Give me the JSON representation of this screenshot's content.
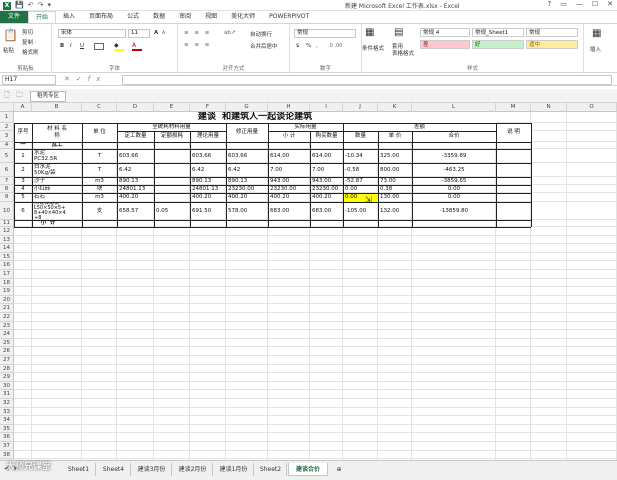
{
  "window": {
    "title": "新建 Microsoft Excel 工作表.xlsx - Excel",
    "controls": [
      "?",
      "▭",
      "—",
      "☐",
      "✕"
    ]
  },
  "quick_access": {
    "save": "💾",
    "undo": "↶",
    "redo": "↷",
    "more": "▾"
  },
  "ribbon_tabs": [
    "文件",
    "开始",
    "插入",
    "页面布局",
    "公式",
    "数据",
    "审阅",
    "视图",
    "美化大师",
    "POWERPIVOT"
  ],
  "active_tab": "开始",
  "ribbon": {
    "clipboard": {
      "paste": "粘贴",
      "cut": "剪切",
      "copy": "复制 ·",
      "format_painter": "格式刷",
      "label": "剪贴板"
    },
    "font": {
      "name": "宋体",
      "size": "11",
      "bold": "B",
      "italic": "I",
      "underline": "U",
      "label": "字体",
      "grow": "A",
      "shrink": "A"
    },
    "alignment": {
      "wrap": "自动换行",
      "merge": "合并后居中",
      "label": "对齐方式"
    },
    "number": {
      "format": "常规",
      "currency": "$",
      "percent": "%",
      "comma": ",",
      "label": "数字"
    },
    "styles": {
      "conditional": "条件格式",
      "table": "套用\n表格格式",
      "cells": [
        {
          "text": "常规 4",
          "bg": "#ffffff"
        },
        {
          "text": "常规_Sheet1",
          "bg": "#ffffff"
        },
        {
          "text": "常规",
          "bg": "#ffffff"
        },
        {
          "text": "差",
          "bg": "#ffc7ce",
          "color": "#9c0006"
        },
        {
          "text": "好",
          "bg": "#c6efce",
          "color": "#006100"
        },
        {
          "text": "适中",
          "bg": "#ffeb9c",
          "color": "#9c5700"
        }
      ],
      "label": "样式"
    },
    "cells_group": {
      "insert": "插入"
    }
  },
  "formula_bar": {
    "name_box": "H17",
    "cancel": "✕",
    "enter": "✓",
    "fx": "fx",
    "value": ""
  },
  "doc_tab": "稻壳专区",
  "columns": [
    "A",
    "B",
    "C",
    "D",
    "E",
    "F",
    "G",
    "H",
    "I",
    "J",
    "K",
    "L",
    "M",
    "N",
    "O"
  ],
  "rows": [
    "1",
    "2",
    "3",
    "4",
    "5",
    "6",
    "7",
    "8",
    "9",
    "10",
    "11",
    "12",
    "13",
    "14",
    "15",
    "16",
    "17",
    "18",
    "19",
    "20",
    "21",
    "22",
    "23",
    "24",
    "25",
    "26",
    "27",
    "28",
    "29",
    "30",
    "31",
    "32",
    "33",
    "34",
    "35",
    "36",
    "37",
    "38",
    "39",
    "40"
  ],
  "sheet": {
    "title": "建谈  和建筑人一起谈论建筑",
    "headers": {
      "seq": "序号",
      "material_name": "材 料 名\n称",
      "unit": "单 位",
      "consumption_group": "全统耗材料用量",
      "quota_amount": "定工数量",
      "quota_loss": "定额损耗",
      "theory": "理论用量",
      "corrected": "修正用量",
      "actual_group": "实际用量",
      "subtotal": "小 计",
      "purchase": "购买数量",
      "diff_group": "差额",
      "qty": "数量",
      "price": "单 价",
      "total": "合价",
      "note": "说 明"
    },
    "section_label_no": "一",
    "section_label": "瓦工",
    "data_rows": [
      {
        "no": "1",
        "name": "水泥\nPC32.5R",
        "unit": "T",
        "d": "603.66",
        "e": "",
        "f": "603.66",
        "g": "603.66",
        "h": "614.00",
        "i": "614.00",
        "j": "-10.34",
        "k": "325.00",
        "l": "-3359.89"
      },
      {
        "no": "2",
        "name": "白水泥\n50Kg/袋",
        "unit": "T",
        "d": "6.42",
        "e": "",
        "f": "6.42",
        "g": "6.42",
        "h": "7.00",
        "i": "7.00",
        "j": "-0.58",
        "k": "800.00",
        "l": "-463.25"
      },
      {
        "no": "3",
        "name": "沙子",
        "unit": "m3",
        "d": "890.13",
        "e": "",
        "f": "890.13",
        "g": "890.13",
        "h": "943.00",
        "i": "943.00",
        "j": "-52.87",
        "k": "73.00",
        "l": "-3859.65"
      },
      {
        "no": "4",
        "name": "小红砖",
        "unit": "块",
        "d": "24801.13",
        "e": "",
        "f": "24801.13",
        "g": "23230.00",
        "h": "23230.00",
        "i": "23230.00",
        "j": "0.00",
        "k": "0.38",
        "l": "0.00"
      },
      {
        "no": "5",
        "name": "石石",
        "unit": "m3",
        "d": "400.20",
        "e": "",
        "f": "400.20",
        "g": "400.20",
        "h": "400.20",
        "i": "400.20",
        "j": "0.00",
        "k": "130.00",
        "l": "0.00"
      },
      {
        "no": "6",
        "name": "热镀锌角钢\nL50×50×5+\n8+40×40×4\n+8",
        "unit": "支",
        "d": "658.57",
        "e": "0.05",
        "f": "691.50",
        "g": "578.00",
        "h": "683.00",
        "i": "683.00",
        "j": "-105.00",
        "k": "132.00",
        "l": "-13859.80"
      }
    ],
    "subtotal_label": "小  计"
  },
  "sheet_tabs": [
    "Sheet1",
    "Sheet4",
    "建谈3月份",
    "建谈2月份",
    "建谈1月份",
    "Sheet2",
    "建谈合价"
  ],
  "active_sheet": "建谈合价",
  "add_sheet": "⊕",
  "watermark": "大师兄课堂",
  "colors": {
    "excel_green": "#217346",
    "highlight": "#ffff00"
  }
}
